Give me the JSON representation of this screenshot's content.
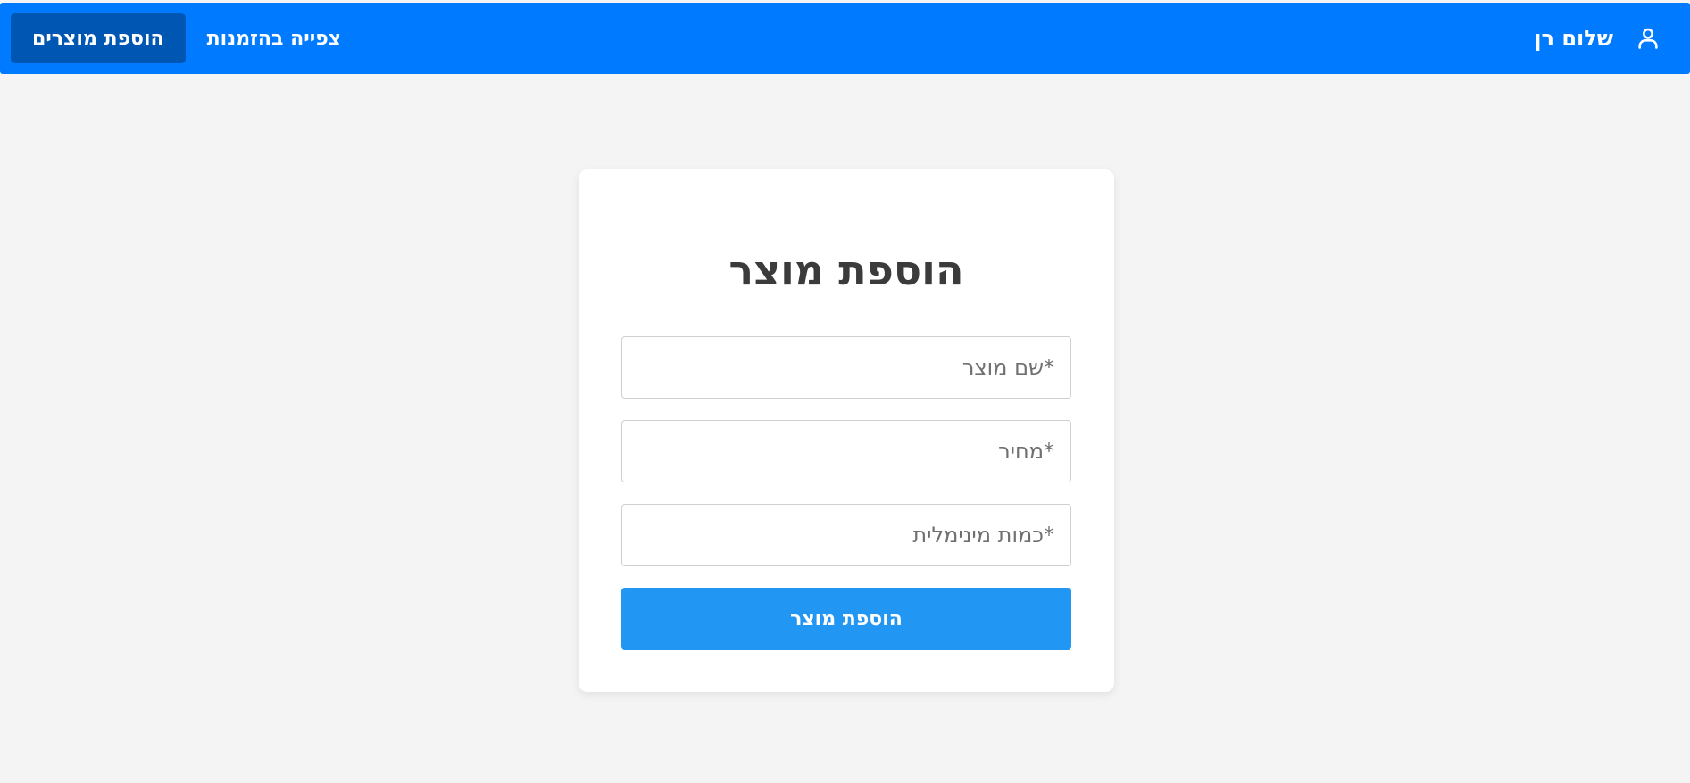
{
  "navbar": {
    "user_name": "שלום רן",
    "user_icon": "user-icon",
    "links": [
      {
        "label": "הוספת מוצרים",
        "active": true
      },
      {
        "label": "צפייה בהזמנות",
        "active": false
      }
    ],
    "background_color": "#007bff",
    "active_color": "#0056b3"
  },
  "form": {
    "title": "הוספת מוצר",
    "fields": [
      {
        "placeholder": "*שם מוצר",
        "value": ""
      },
      {
        "placeholder": "*מחיר",
        "value": ""
      },
      {
        "placeholder": "*כמות מינימלית",
        "value": ""
      }
    ],
    "submit_label": "הוספת מוצר",
    "submit_color": "#2196f3"
  }
}
